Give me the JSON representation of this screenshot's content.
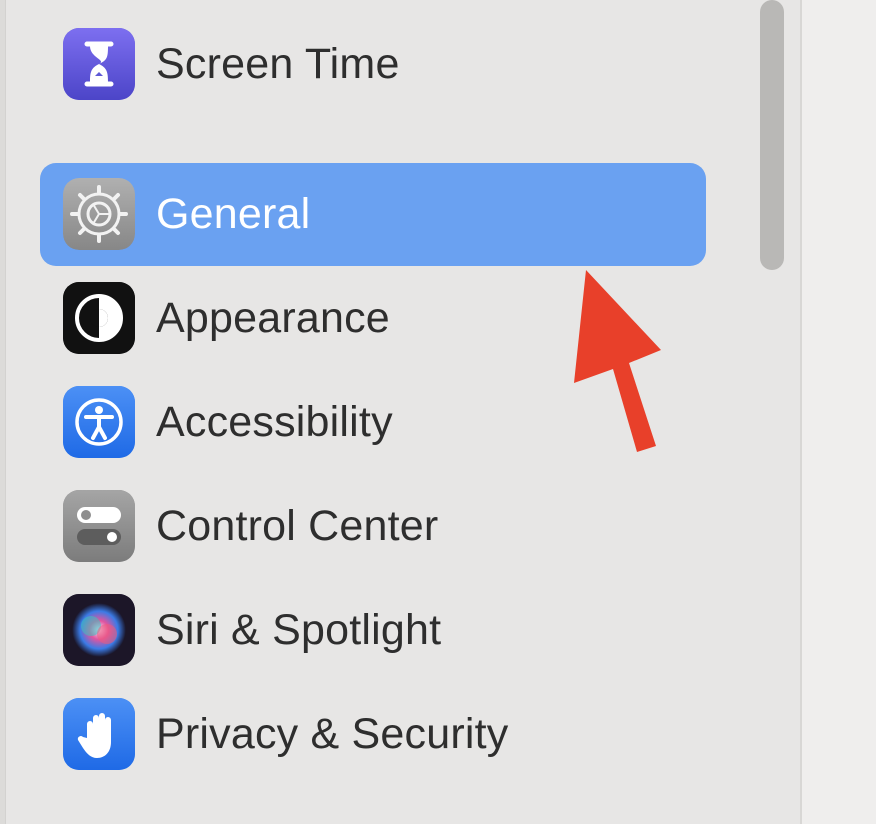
{
  "sidebar": {
    "items": [
      {
        "label": "Screen Time",
        "icon": "hourglass-icon",
        "color": "#5f5ad6"
      },
      {
        "label": "General",
        "icon": "gear-icon",
        "color": "#9a9a9a",
        "selected": true
      },
      {
        "label": "Appearance",
        "icon": "appearance-icon",
        "color": "#111111"
      },
      {
        "label": "Accessibility",
        "icon": "accessibility-icon",
        "color": "#2f7cf0"
      },
      {
        "label": "Control Center",
        "icon": "toggles-icon",
        "color": "#8e8e8e"
      },
      {
        "label": "Siri & Spotlight",
        "icon": "siri-icon",
        "color": "#2a1f3a"
      },
      {
        "label": "Privacy & Security",
        "icon": "hand-icon",
        "color": "#2f7cf0"
      }
    ]
  },
  "colors": {
    "selection": "#6aa1f1",
    "annotation_arrow": "#e8402a"
  }
}
